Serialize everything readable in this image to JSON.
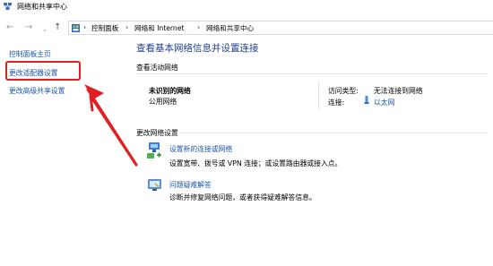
{
  "window": {
    "title": "网络和共享中心"
  },
  "address": {
    "crumbs": [
      "控制面板",
      "网络和 Internet",
      "网络和共享中心"
    ]
  },
  "sidebar": {
    "items": [
      {
        "label": "控制面板主页"
      },
      {
        "label": "更改适配器设置"
      },
      {
        "label": "更改高级共享设置"
      }
    ]
  },
  "main": {
    "heading": "查看基本网络信息并设置连接",
    "active_section": "查看活动网络",
    "network": {
      "name": "未识别的网络",
      "type": "公用网络",
      "access_label": "访问类型:",
      "access_value": "无法连接到网络",
      "conn_label": "连接:",
      "conn_value": "以太网"
    },
    "change_section": "更改网络设置",
    "actions": [
      {
        "title": "设置新的连接或网络",
        "desc": "设置宽带、拨号或 VPN 连接；或设置路由器或接入点。"
      },
      {
        "title": "问题疑难解答",
        "desc": "诊断并修复网络问题，或者获得疑难解答信息。"
      }
    ]
  },
  "colors": {
    "link": "#1a56b0",
    "heading": "#1e3f90",
    "annotation": "#e02020"
  }
}
